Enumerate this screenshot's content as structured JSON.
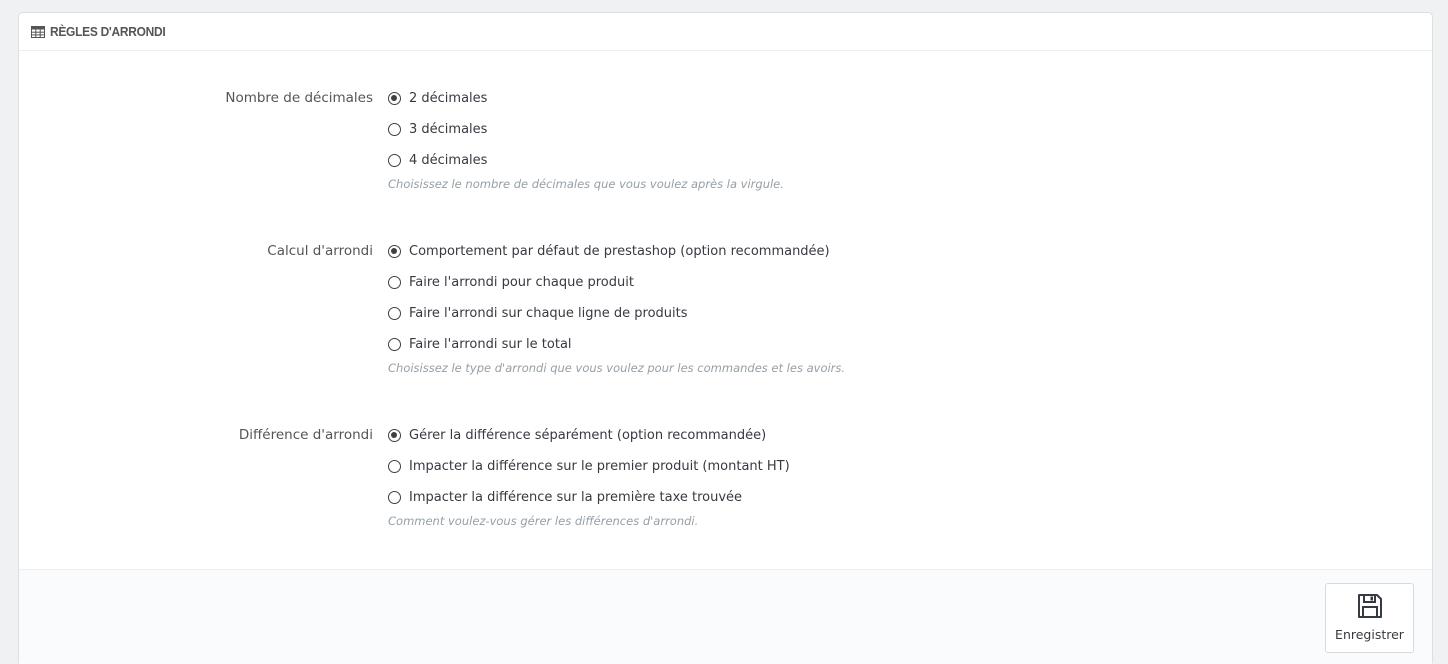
{
  "panel": {
    "title": "RÈGLES D'ARRONDI",
    "icon": "calculator-grid-icon"
  },
  "decimals": {
    "label": "Nombre de décimales",
    "options": [
      {
        "label": "2 décimales",
        "checked": true
      },
      {
        "label": "3 décimales",
        "checked": false
      },
      {
        "label": "4 décimales",
        "checked": false
      }
    ],
    "help": "Choisissez le nombre de décimales que vous voulez après la virgule."
  },
  "rounding_calc": {
    "label": "Calcul d'arrondi",
    "options": [
      {
        "label": "Comportement par défaut de prestashop (option recommandée)",
        "checked": true
      },
      {
        "label": "Faire l'arrondi pour chaque produit",
        "checked": false
      },
      {
        "label": "Faire l'arrondi sur chaque ligne de produits",
        "checked": false
      },
      {
        "label": "Faire l'arrondi sur le total",
        "checked": false
      }
    ],
    "help": "Choisissez le type d'arrondi que vous voulez pour les commandes et les avoirs."
  },
  "rounding_diff": {
    "label": "Différence d'arrondi",
    "options": [
      {
        "label": "Gérer la différence séparément (option recommandée)",
        "checked": true
      },
      {
        "label": "Impacter la différence sur le premier produit (montant HT)",
        "checked": false
      },
      {
        "label": "Impacter la différence sur la première taxe trouvée",
        "checked": false
      }
    ],
    "help": "Comment voulez-vous gérer les différences d'arrondi."
  },
  "footer": {
    "save_label": "Enregistrer",
    "save_icon": "floppy-disk-icon"
  }
}
